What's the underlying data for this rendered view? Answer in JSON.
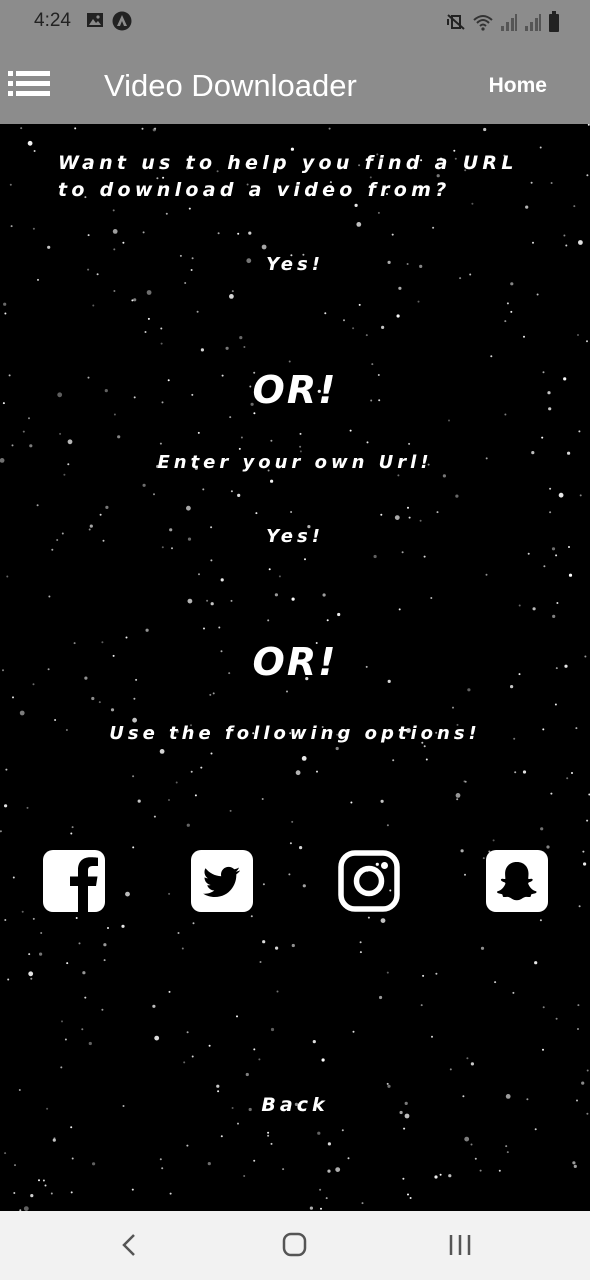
{
  "status_bar": {
    "time": "4:24",
    "left_icons": [
      "image-icon",
      "notification-app-icon"
    ],
    "right_icons": [
      "mute-vibrate-icon",
      "wifi-icon",
      "signal-icon",
      "signal-icon",
      "battery-icon"
    ]
  },
  "app_bar": {
    "menu_icon": "hamburger-menu-icon",
    "title": "Video Downloader",
    "home_label": "Home"
  },
  "main": {
    "prompt": "Want us to help you find a URL to download a video from?",
    "yes_label_1": "Yes!",
    "or_1": "OR!",
    "enter_url": "Enter your own Url!",
    "yes_label_2": "Yes!",
    "or_2": "OR!",
    "use_options": "Use the following options!",
    "social_options": [
      "facebook-icon",
      "twitter-icon",
      "instagram-icon",
      "snapchat-icon"
    ],
    "back_label": "Back"
  },
  "nav_bar": {
    "buttons": [
      "back-nav-icon",
      "home-nav-icon",
      "recents-nav-icon"
    ]
  },
  "colors": {
    "app_bar": "#8c8c8c",
    "background": "#000000",
    "text": "#ffffff",
    "nav_bar": "#f2f2f2"
  }
}
